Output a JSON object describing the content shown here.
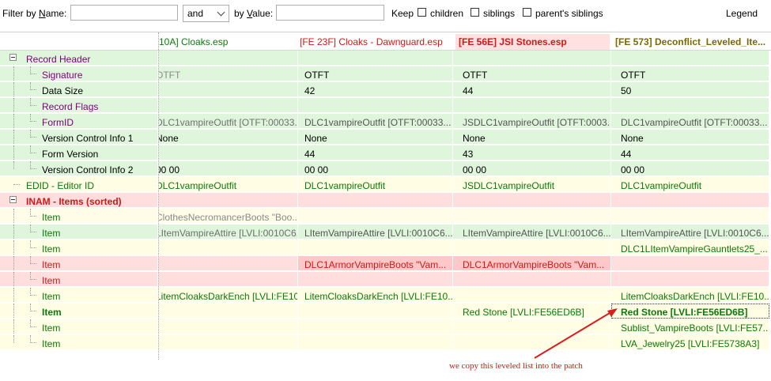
{
  "filter": {
    "by_name_prefix": "Filter by ",
    "by_name_key": "N",
    "by_name_suffix": "ame:",
    "name_value": "",
    "operator": "and",
    "by_value_prefix": "by ",
    "by_value_key": "V",
    "by_value_suffix": "alue:",
    "value_value": "",
    "keep_label": "Keep",
    "children_label": "children",
    "siblings_label": "siblings",
    "parents_siblings_label": "parent's siblings",
    "legend_label": "Legend"
  },
  "columns": [
    "10A] Cloaks.esp",
    "[FE 23F] Cloaks - Dawnguard.esp",
    "[FE 56E] JSI Stones.esp",
    "[FE 573] Deconflict_Leveled_Ite..."
  ],
  "rows": [
    {
      "label": "Record Header",
      "cells": [
        "",
        "",
        "",
        ""
      ]
    },
    {
      "label": "Signature",
      "cells": [
        "OTFT",
        "OTFT",
        "OTFT",
        "OTFT"
      ]
    },
    {
      "label": "Data Size",
      "cells": [
        "",
        "42",
        "44",
        "50"
      ]
    },
    {
      "label": "Record Flags",
      "cells": [
        "",
        "",
        "",
        ""
      ]
    },
    {
      "label": "FormID",
      "cells": [
        "DLC1vampireOutfit [OTFT:00033...",
        "DLC1vampireOutfit [OTFT:00033...",
        "JSDLC1vampireOutfit [OTFT:0003...",
        "DLC1vampireOutfit [OTFT:00033..."
      ]
    },
    {
      "label": "Version Control Info 1",
      "cells": [
        "None",
        "None",
        "None",
        "None"
      ]
    },
    {
      "label": "Form Version",
      "cells": [
        "",
        "44",
        "43",
        "44"
      ]
    },
    {
      "label": "Version Control Info 2",
      "cells": [
        "00 00",
        "00 00",
        "00 00",
        "00 00"
      ]
    },
    {
      "label": "EDID - Editor ID",
      "cells": [
        "DLC1vampireOutfit",
        "DLC1vampireOutfit",
        "JSDLC1vampireOutfit",
        "DLC1vampireOutfit"
      ]
    },
    {
      "label": "INAM - Items (sorted)",
      "cells": [
        "",
        "",
        "",
        ""
      ]
    },
    {
      "label": "Item",
      "cells": [
        "ClothesNecromancerBoots \"Boo...",
        "",
        "",
        ""
      ]
    },
    {
      "label": "Item",
      "cells": [
        "LItemVampireAttire [LVLI:0010C6...",
        "LItemVampireAttire [LVLI:0010C6...",
        "LItemVampireAttire [LVLI:0010C6...",
        "LItemVampireAttire [LVLI:0010C6..."
      ]
    },
    {
      "label": "Item",
      "cells": [
        "",
        "",
        "",
        "DLC1LItemVampireGauntlets25_..."
      ]
    },
    {
      "label": "Item",
      "cells": [
        "",
        "DLC1ArmorVampireBoots \"Vam...",
        "DLC1ArmorVampireBoots \"Vam...",
        ""
      ]
    },
    {
      "label": "Item",
      "cells": [
        "",
        "",
        "",
        ""
      ]
    },
    {
      "label": "Item",
      "cells": [
        "LitemCloaksDarkEnch [LVLI:FE10...",
        "LitemCloaksDarkEnch [LVLI:FE10...",
        "",
        "LitemCloaksDarkEnch [LVLI:FE10..."
      ]
    },
    {
      "label": "Item",
      "cells": [
        "",
        "",
        "Red Stone [LVLI:FE56ED6B]",
        "Red Stone [LVLI:FE56ED6B]"
      ]
    },
    {
      "label": "Item",
      "cells": [
        "",
        "",
        "",
        "Sublist_VampireBoots [LVLI:FE57..."
      ]
    },
    {
      "label": "Item",
      "cells": [
        "",
        "",
        "",
        "LVA_Jewelry25 [LVLI:FE5738A3]"
      ]
    }
  ],
  "annotation": "we copy this leveled list into the patch",
  "colors": {
    "green_bg": "#dff5dc",
    "yellow_bg": "#fffde4",
    "red_bg": "#ffdede",
    "green_text": "#0a7a0a",
    "red_text": "#d01818",
    "purple_text": "#800080",
    "olive_text": "#7a6a00",
    "arrow": "#d42020"
  }
}
